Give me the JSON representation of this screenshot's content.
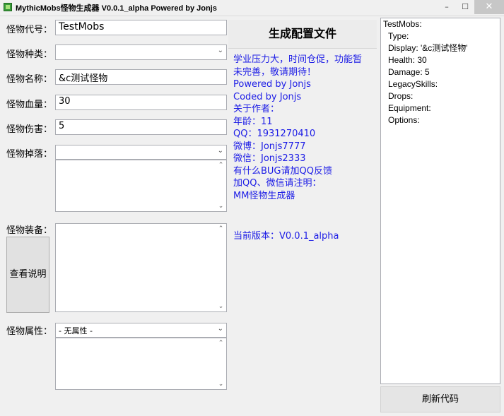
{
  "window": {
    "title": "MythicMobs怪物生成器 V0.0.1_alpha    Powered by Jonjs",
    "min_glyph": "–",
    "max_glyph": "☐",
    "close_glyph": "✕"
  },
  "form": {
    "id_label": "怪物代号：",
    "id_value": "TestMobs",
    "type_label": "怪物种类：",
    "type_value": "",
    "name_label": "怪物名称：",
    "name_value": "&c测试怪物",
    "health_label": "怪物血量：",
    "health_value": "30",
    "damage_label": "怪物伤害：",
    "damage_value": "5",
    "drops_label": "怪物掉落：",
    "drops_value": "",
    "equip_label": "怪物装备：",
    "attr_label": "怪物属性：",
    "attr_value": "- 无属性 -"
  },
  "buttons": {
    "generate": "生成配置文件",
    "help": "查看说明",
    "refresh": "刷新代码"
  },
  "info_lines": [
    "学业压力大，时间仓促，功能暂",
    "未完善，敬请期待！",
    "Powered by Jonjs",
    "Coded by Jonjs",
    "关于作者：",
    "年龄：11",
    "QQ：1931270410",
    "微博：Jonjs7777",
    "微信：Jonjs2333",
    "有什么BUG请加QQ反馈",
    "加QQ、微信请注明：",
    "MM怪物生成器"
  ],
  "version_text": "当前版本：V0.0.1_alpha",
  "output_lines": {
    "l0": "TestMobs:",
    "l1": "Type:",
    "l2": "Display: '&c测试怪物'",
    "l3": "Health: 30",
    "l4": "Damage: 5",
    "l5": "LegacySkills:",
    "l6": "Drops:",
    "l7": "Equipment:",
    "l8": "Options:"
  },
  "colors": {
    "info_text": "#1c1ce6",
    "close_button": "#c7c7c7"
  }
}
